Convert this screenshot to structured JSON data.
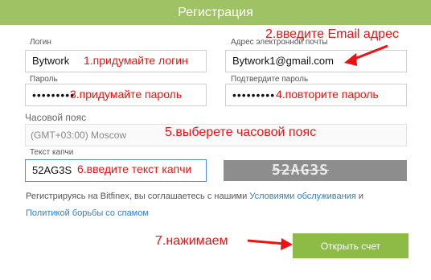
{
  "header": {
    "title": "Регистрация"
  },
  "form": {
    "login_label": "Логин",
    "login_value": "Bytwork",
    "email_label": "Адрес электронной почты",
    "email_value": "Bytwork1@gmail.com",
    "password_label": "Пароль",
    "password_mask": "•••••••••",
    "confirm_label": "Подтвердите пароль",
    "confirm_mask": "•••••••••",
    "timezone_label": "Часовой пояс",
    "timezone_value": "(GMT+03:00) Moscow",
    "captcha_label": "Текст капчи",
    "captcha_value": "52AG3S",
    "captcha_image_text": "52AG3S",
    "terms_text": "Регистрируясь на Bitfinex, вы соглашаетесь с нашими ",
    "terms_link": "Условиями обслуживания",
    "terms_and": " и",
    "policy_link": "Политикой борьбы со спамом",
    "submit_label": "Открыть счет"
  },
  "annotations": {
    "email": "2.введите Email адрес",
    "login": "1.придумайте логин",
    "password": "3.придумайте пароль",
    "confirm": "4.повторите пароль",
    "timezone": "5.выберете часовой пояс",
    "captcha": "6.введите текст капчи",
    "submit": "7.нажимаем"
  },
  "colors": {
    "header_bg": "#9fc264",
    "button_bg": "#8cbc46",
    "annotation": "#ee1111",
    "link": "#2f7fc8"
  }
}
